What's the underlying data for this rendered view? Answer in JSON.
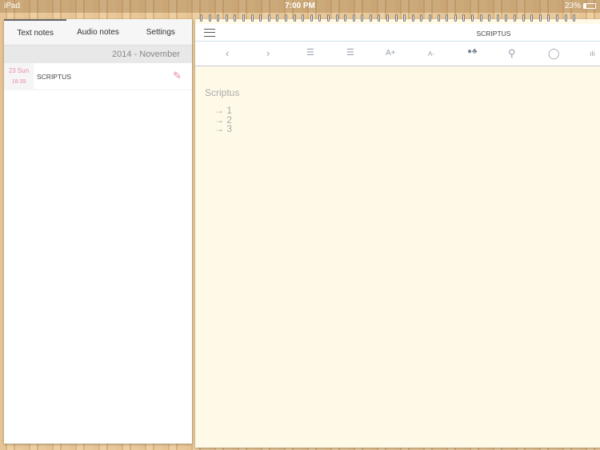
{
  "status": {
    "device": "iPad",
    "time": "7:00 PM",
    "battery": "23%",
    "battery_level": 0.23
  },
  "left": {
    "tabs": [
      "Text notes",
      "Audio notes",
      "Settings"
    ],
    "month": "2014 - November",
    "notes": [
      {
        "day": "23 Sun",
        "time": "18:39",
        "title": "SCRIPTUS"
      }
    ]
  },
  "editor": {
    "title": "SCRIPTUS",
    "note_title": "Scriptus",
    "lines": [
      "→ 1",
      "→ 2",
      "→ 3"
    ],
    "toolbar": {
      "a_plus": "A+",
      "a_minus": "A-"
    }
  }
}
